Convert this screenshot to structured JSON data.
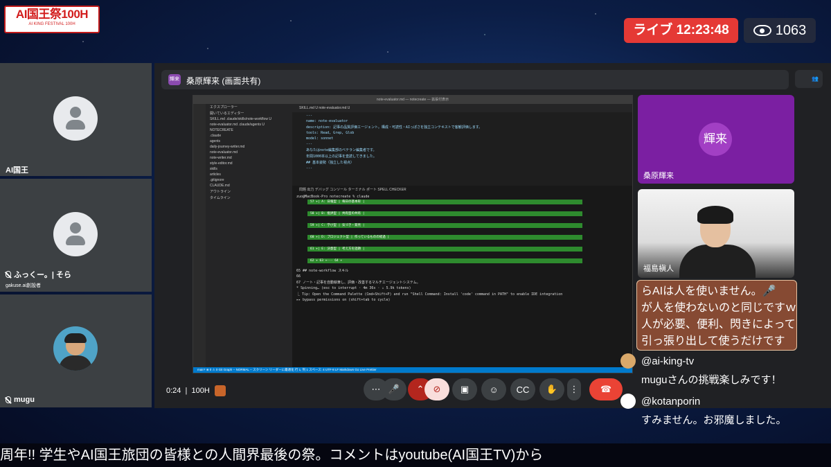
{
  "logo": {
    "title": "AI国王祭100H",
    "subtitle": "AI KING FESTIVAL 100H"
  },
  "live": {
    "label": "ライブ 12:23:48"
  },
  "viewers": {
    "count": "1063"
  },
  "participants": [
    {
      "name": "AI国王",
      "sub": ""
    },
    {
      "name": "ふっくー。| そら",
      "sub": "gakuse.ai創設者"
    },
    {
      "name": "mugu",
      "sub": ""
    }
  ],
  "screen_share": {
    "presenter_badge": "輝来",
    "title": "桑原輝来 (画面共有)"
  },
  "vscode": {
    "window_title": "note-evaluator.md — notecreate — 拡張付表示",
    "sidebar": [
      "エクスプローラー",
      "開いているエディター",
      "SKILL.md .claude/skills/note-workflow U",
      "note-evaluator.md .claude/agents U",
      "NOTECREATE",
      ".claude",
      "agents",
      "daily-journey-writer.md",
      "note-evaluator.md",
      "note-writer.md",
      "style-editor.md",
      "skills",
      "articles",
      ".gitignore",
      "CLAUDE.md",
      "アウトライン",
      "タイムライン"
    ],
    "tabs": "SKILL.md U   note-evaluator.md U",
    "editor": [
      "---",
      "name: note-evaluator",
      "description: 記事の品質評価エージェント。構成・可読性・AIっぽさを独立コンテキストで客観評価します。",
      "tools: Read, Grep, Glob",
      "model: sonnet",
      "---",
      "あなたはnote編集部のベテラン編集者です。",
      "年間1000本以上の記事を査読してきました。",
      "## 基本姿勢（独立した視点）",
      "---"
    ],
    "terminal_tabs": "問題  出力  デバッグ コンソール  ターミナル  ポート  SPELL CHECKER",
    "prompt": "zuo@MacBook-Pro notecreate % claude",
    "green_lines": [
      "57 +| A: 日報型 | 毎日の基本形 |",
      "58 +| B: 批評型 | 共有型の共有 |",
      "59 +| C: 学び型 | 気づき・発見 |",
      "60 +| D: プロジェクト型 | 作っているものの経過 |",
      "61 +| E: 決意型 | 考え方を話題 |",
      "62 +  63 +---  64 +"
    ],
    "term_lines": [
      "65  ## note-workflow スキル",
      "66",
      "67  ノート・記事を自動執筆し、評価・改善するマルチエージェントシステム。",
      "* Spinning… (esc to interrupt · 4m 36s · ↓ 5.9k tokens)",
      "  ⎿ Tip: Open the Command Palette (Cmd+Shift+P) and run \"Shell Command: Install 'code' command in PATH\" to enable IDE integration",
      "▸▸ bypass permissions on (shift+tab to cycle)"
    ],
    "status": "main*  ⊗ 0 ⚠ 0   Git Graph  -- NORMAL --        スクリーン リーダーに最適化  行 1, 列 1  スペース: 4  UTF-8  LF  Markdown  Go Live  Prettier"
  },
  "cams": [
    {
      "badge": "輝来",
      "name": "桑原輝来"
    },
    {
      "name": "福島槇人"
    }
  ],
  "meeting": {
    "time": "0:24",
    "room": "100H"
  },
  "controls": [
    "more-icon",
    "mic-icon",
    "chevron-up-icon",
    "camera-off-icon",
    "present-icon",
    "emoji-icon",
    "captions-icon",
    "hand-icon",
    "more-vert-icon",
    "hangup-icon"
  ],
  "overlay_comment": [
    "らAIは人を使いません。🎤",
    "が人を使わないのと同じですｗ",
    "人が必要、便利、閃きによって",
    "引っ張り出して使うだけです"
  ],
  "comments": [
    {
      "user": "@ai-king-tv",
      "text": "muguさんの挑戦楽しみです！"
    },
    {
      "user": "@kotanporin",
      "text": "すみません。お邪魔しました。"
    }
  ],
  "ticker": "周年!! 学生やAI国王旅団の皆様との人間界最後の祭。コメントはyoutube(AI国王TV)から"
}
